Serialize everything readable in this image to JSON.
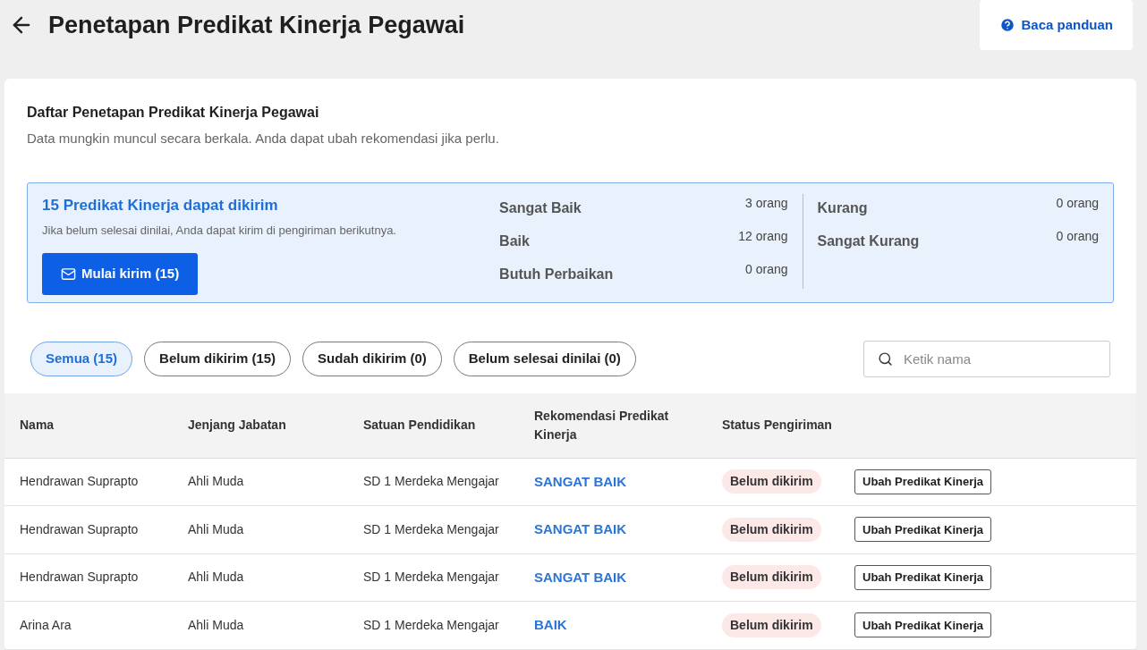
{
  "header": {
    "title": "Penetapan Predikat Kinerja Pegawai",
    "guide_button": "Baca panduan"
  },
  "card": {
    "title": "Daftar Penetapan Predikat Kinerja Pegawai",
    "subtitle": "Data mungkin muncul secara berkala. Anda dapat ubah rekomendasi jika perlu."
  },
  "summary": {
    "title": "15 Predikat Kinerja dapat dikirim",
    "note": "Jika belum selesai dinilai, Anda dapat kirim di pengiriman berikutnya.",
    "send_button": "Mulai kirim (15)",
    "groups": [
      [
        {
          "label": "Sangat Baik",
          "count": "3 orang"
        },
        {
          "label": "Baik",
          "count": "12 orang"
        },
        {
          "label": "Butuh Perbaikan",
          "count": "0 orang"
        }
      ],
      [
        {
          "label": "Kurang",
          "count": "0 orang"
        },
        {
          "label": "Sangat Kurang",
          "count": "0 orang"
        }
      ]
    ]
  },
  "filters": [
    {
      "label": "Semua (15)",
      "selected": true
    },
    {
      "label": "Belum dikirim (15)",
      "selected": false
    },
    {
      "label": "Sudah dikirim (0)",
      "selected": false
    },
    {
      "label": "Belum selesai dinilai (0)",
      "selected": false
    }
  ],
  "search": {
    "placeholder": "Ketik nama"
  },
  "table": {
    "columns": [
      "Nama",
      "Jenjang Jabatan",
      "Satuan Pendidikan",
      "Rekomendasi Predikat Kinerja",
      "Status Pengiriman"
    ],
    "rows": [
      {
        "name": "Hendrawan Suprapto",
        "level": "Ahli Muda",
        "unit": "SD 1 Merdeka Mengajar",
        "recommendation": "SANGAT BAIK",
        "status": "Belum dikirim",
        "action": "Ubah Predikat Kinerja"
      },
      {
        "name": "Hendrawan Suprapto",
        "level": "Ahli Muda",
        "unit": "SD 1 Merdeka Mengajar",
        "recommendation": "SANGAT BAIK",
        "status": "Belum dikirim",
        "action": "Ubah Predikat Kinerja"
      },
      {
        "name": "Hendrawan Suprapto",
        "level": "Ahli Muda",
        "unit": "SD 1 Merdeka Mengajar",
        "recommendation": "SANGAT BAIK",
        "status": "Belum dikirim",
        "action": "Ubah Predikat Kinerja"
      },
      {
        "name": "Arina Ara",
        "level": "Ahli Muda",
        "unit": "SD 1 Merdeka Mengajar",
        "recommendation": "BAIK",
        "status": "Belum dikirim",
        "action": "Ubah Predikat Kinerja"
      }
    ]
  }
}
